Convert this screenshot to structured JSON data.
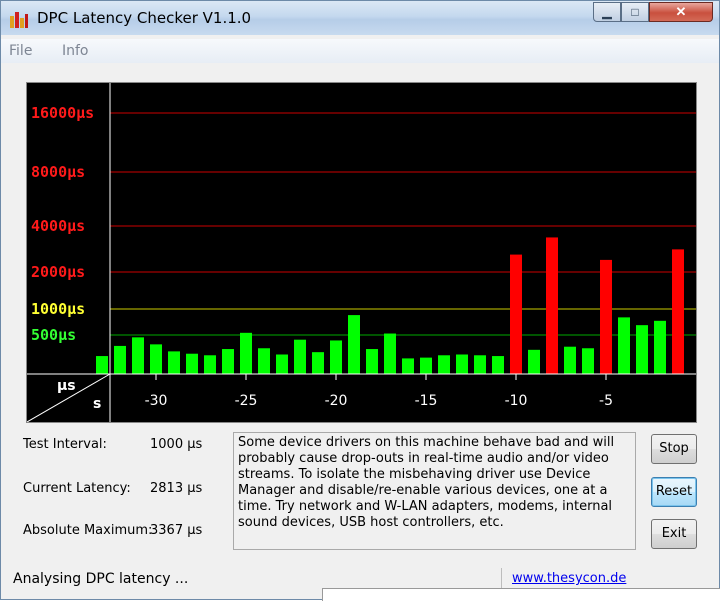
{
  "window": {
    "title": "DPC Latency Checker V1.1.0"
  },
  "controls": {
    "minimize": "▁",
    "maximize": "□",
    "close": "✕"
  },
  "menu": [
    {
      "label": "File"
    },
    {
      "label": "Info"
    }
  ],
  "chart_data": {
    "type": "bar",
    "ylabels": [
      {
        "text": "16000µs",
        "color": "#ff1a1a",
        "level": 16000
      },
      {
        "text": "8000µs",
        "color": "#ff1a1a",
        "level": 8000
      },
      {
        "text": "4000µs",
        "color": "#ff1a1a",
        "level": 4000
      },
      {
        "text": "2000µs",
        "color": "#ff1a1a",
        "level": 2000
      },
      {
        "text": "1000µs",
        "color": "#ffff33",
        "level": 1000
      },
      {
        "text": "500µs",
        "color": "#33ff33",
        "level": 500
      }
    ],
    "corner_labels": {
      "y_unit": "µs",
      "x_unit": "s"
    },
    "xticks": [
      "-30",
      "-25",
      "-20",
      "-15",
      "-10",
      "-5"
    ],
    "xtick_values": [
      -30,
      -25,
      -20,
      -15,
      -10,
      -5
    ],
    "x": [
      -33,
      -32,
      -31,
      -30,
      -29,
      -28,
      -27,
      -26,
      -25,
      -24,
      -23,
      -22,
      -21,
      -20,
      -19,
      -18,
      -17,
      -16,
      -15,
      -14,
      -13,
      -12,
      -11,
      -10,
      -9,
      -8,
      -7,
      -6,
      -5,
      -4,
      -3,
      -2,
      -1
    ],
    "values": [
      230,
      360,
      470,
      380,
      290,
      260,
      240,
      320,
      530,
      330,
      250,
      440,
      280,
      430,
      850,
      320,
      520,
      200,
      210,
      240,
      250,
      240,
      230,
      2600,
      310,
      3367,
      350,
      330,
      2400,
      800,
      650,
      730,
      2813
    ],
    "colors": {
      "ok": "#00ff00",
      "bad": "#ff0000",
      "grid_red": "#cc0000",
      "grid_yellow": "#cccc00",
      "grid_green": "#00aa00"
    }
  },
  "stats": {
    "test_interval_label": "Test Interval:",
    "test_interval_value": "1000 µs",
    "current_latency_label": "Current Latency:",
    "current_latency_value": "2813 µs",
    "absolute_max_label": "Absolute Maximum:",
    "absolute_max_value": "3367 µs"
  },
  "message": "Some device drivers on this machine behave bad and will probably cause drop-outs in real-time audio and/or video streams. To isolate the misbehaving driver use Device Manager and disable/re-enable various devices, one at a time. Try network and W-LAN adapters, modems, internal sound devices, USB host controllers, etc.",
  "buttons": {
    "stop": "Stop",
    "reset": "Reset",
    "exit": "Exit"
  },
  "status": {
    "text": "Analysing DPC latency ...",
    "link": "www.thesycon.de"
  }
}
